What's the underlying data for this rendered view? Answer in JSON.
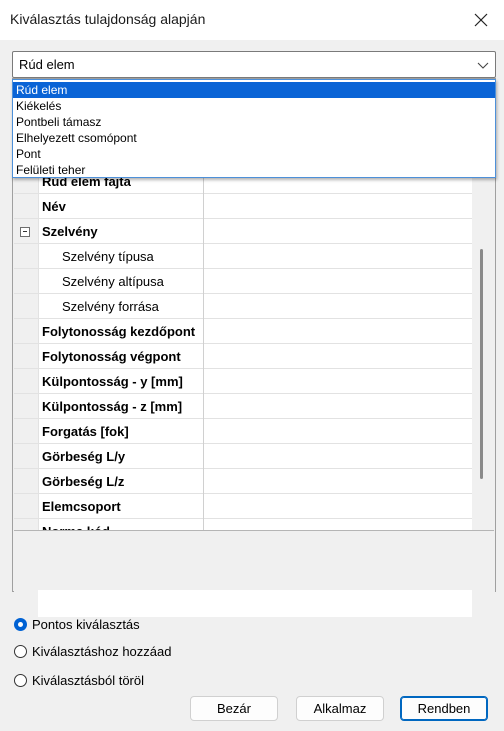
{
  "window": {
    "title": "Kiválasztás tulajdonság alapján"
  },
  "combo": {
    "value": "Rúd elem",
    "options": [
      "Rúd elem",
      "Kiékelés",
      "Pontbeli támasz",
      "Elhelyezett csomópont",
      "Pont",
      "Felületi teher"
    ]
  },
  "grid": {
    "partial_row": "Rúd elem fajta",
    "rows": [
      {
        "label": "Név",
        "bold": true
      },
      {
        "label": "Szelvény",
        "bold": true,
        "expander": true
      },
      {
        "label": "Szelvény típusa",
        "bold": false,
        "sub": true
      },
      {
        "label": "Szelvény altípusa",
        "bold": false,
        "sub": true
      },
      {
        "label": "Szelvény forrása",
        "bold": false,
        "sub": true
      },
      {
        "label": "Folytonosság kezdőpont",
        "bold": true
      },
      {
        "label": "Folytonosság végpont",
        "bold": true
      },
      {
        "label": "Külpontosság - y [mm]",
        "bold": true
      },
      {
        "label": "Külpontosság - z [mm]",
        "bold": true
      },
      {
        "label": "Forgatás [fok]",
        "bold": true
      },
      {
        "label": "Görbeség L/y",
        "bold": true
      },
      {
        "label": "Görbeség L/z",
        "bold": true
      },
      {
        "label": "Elemcsoport",
        "bold": true
      },
      {
        "label": "Norma kód",
        "bold": true
      }
    ]
  },
  "radios": {
    "options": [
      "Pontos kiválasztás",
      "Kiválasztáshoz hozzáad",
      "Kiválasztásból töröl"
    ],
    "selected_index": 0
  },
  "buttons": {
    "close": "Bezár",
    "apply": "Alkalmaz",
    "ok": "Rendben"
  },
  "colors": {
    "accent": "#0a64d6",
    "dropdown_border": "#4d90d9"
  }
}
